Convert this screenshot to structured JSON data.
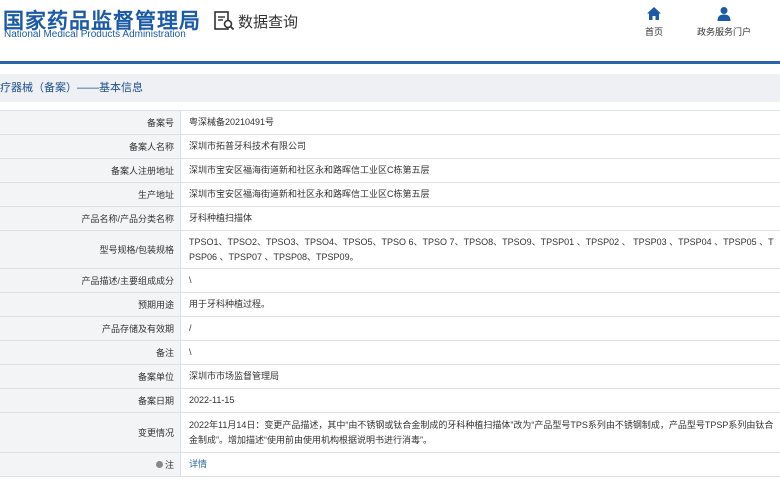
{
  "header": {
    "logo_cn": "国家药品监督管理局",
    "logo_en": "National Medical Products Administration",
    "query_label": "数据查询",
    "nav_home": "首页",
    "nav_portal": "政务服务门户"
  },
  "section_title": "疗器械（备案）——基本信息",
  "rows": [
    {
      "label": "备案号",
      "value": "粤深械备20210491号"
    },
    {
      "label": "备案人名称",
      "value": "深圳市拓普牙科技术有限公司"
    },
    {
      "label": "备案人注册地址",
      "value": "深圳市宝安区福海街道新和社区永和路晖信工业区C栋第五层"
    },
    {
      "label": "生产地址",
      "value": "深圳市宝安区福海街道新和社区永和路晖信工业区C栋第五层"
    },
    {
      "label": "产品名称/产品分类名称",
      "value": "牙科种植扫描体"
    },
    {
      "label": "型号规格/包装规格",
      "value": "TPSO1、TPSO2、TPSO3、TPSO4、TPSO5、TPSO 6、TPSO 7、TPSO8、TPSO9、TPSP01 、TPSP02 、 TPSP03 、TPSP04 、TPSP05 、TPSP06 、TPSP07 、TPSP08、TPSP09。"
    },
    {
      "label": "产品描述/主要组成成分",
      "value": "\\"
    },
    {
      "label": "预期用途",
      "value": "用于牙科种植过程。"
    },
    {
      "label": "产品存储及有效期",
      "value": "/"
    },
    {
      "label": "备注",
      "value": "\\"
    },
    {
      "label": "备案单位",
      "value": "深圳市市场监督管理局"
    },
    {
      "label": "备案日期",
      "value": "2022-11-15"
    },
    {
      "label": "变更情况",
      "value": "2022年11月14日：变更产品描述，其中“由不锈钢或钛合金制成的牙科种植扫描体”改为“产品型号TPS系列由不锈钢制成，产品型号TPSP系列由钛合金制成”。增加描述“使用前由使用机构根据说明书进行消毒”。"
    },
    {
      "label": "注",
      "value": "详情"
    }
  ],
  "colors": {
    "brand_blue": "#1a5aa6",
    "header_line": "#2a63a9",
    "label_bg": "#f3f4f6"
  }
}
